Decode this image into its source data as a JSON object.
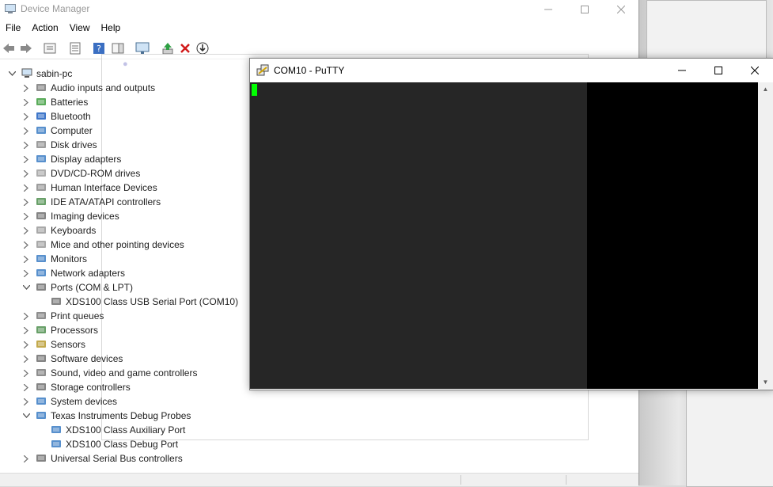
{
  "device_manager": {
    "title": "Device Manager",
    "menu": [
      "File",
      "Action",
      "View",
      "Help"
    ],
    "tree": {
      "root": "sabin-pc",
      "items": [
        {
          "label": "Audio inputs and outputs",
          "icon": "speaker-icon",
          "expanded": false
        },
        {
          "label": "Batteries",
          "icon": "battery-icon",
          "expanded": false
        },
        {
          "label": "Bluetooth",
          "icon": "bluetooth-icon",
          "expanded": false
        },
        {
          "label": "Computer",
          "icon": "computer-icon",
          "expanded": false
        },
        {
          "label": "Disk drives",
          "icon": "disk-drive-icon",
          "expanded": false
        },
        {
          "label": "Display adapters",
          "icon": "display-adapter-icon",
          "expanded": false
        },
        {
          "label": "DVD/CD-ROM drives",
          "icon": "dvd-drive-icon",
          "expanded": false
        },
        {
          "label": "Human Interface Devices",
          "icon": "hid-icon",
          "expanded": false
        },
        {
          "label": "IDE ATA/ATAPI controllers",
          "icon": "ide-controller-icon",
          "expanded": false
        },
        {
          "label": "Imaging devices",
          "icon": "camera-icon",
          "expanded": false
        },
        {
          "label": "Keyboards",
          "icon": "keyboard-icon",
          "expanded": false
        },
        {
          "label": "Mice and other pointing devices",
          "icon": "mouse-icon",
          "expanded": false
        },
        {
          "label": "Monitors",
          "icon": "monitor-icon",
          "expanded": false
        },
        {
          "label": "Network adapters",
          "icon": "network-adapter-icon",
          "expanded": false
        },
        {
          "label": "Ports (COM & LPT)",
          "icon": "port-icon",
          "expanded": true
        },
        {
          "label": "XDS100 Class USB Serial Port (COM10)",
          "icon": "port-connector-icon",
          "child": true
        },
        {
          "label": "Print queues",
          "icon": "printer-icon",
          "expanded": false
        },
        {
          "label": "Processors",
          "icon": "processor-icon",
          "expanded": false
        },
        {
          "label": "Sensors",
          "icon": "sensor-icon",
          "expanded": false
        },
        {
          "label": "Software devices",
          "icon": "software-device-icon",
          "expanded": false
        },
        {
          "label": "Sound, video and game controllers",
          "icon": "sound-icon",
          "expanded": false
        },
        {
          "label": "Storage controllers",
          "icon": "storage-controller-icon",
          "expanded": false
        },
        {
          "label": "System devices",
          "icon": "system-device-icon",
          "expanded": false
        },
        {
          "label": "Texas Instruments Debug Probes",
          "icon": "debug-probe-icon",
          "expanded": true
        },
        {
          "label": "XDS100 Class Auxiliary Port",
          "icon": "debug-port-icon",
          "child": true
        },
        {
          "label": "XDS100 Class Debug Port",
          "icon": "debug-port-icon",
          "child": true
        },
        {
          "label": "Universal Serial Bus controllers",
          "icon": "usb-icon",
          "expanded": false
        }
      ]
    }
  },
  "putty": {
    "title": "COM10 - PuTTY",
    "cursor_color": "#00ff00"
  },
  "colors": {
    "terminal_bg": "#000000",
    "title_inactive": "#999999"
  }
}
